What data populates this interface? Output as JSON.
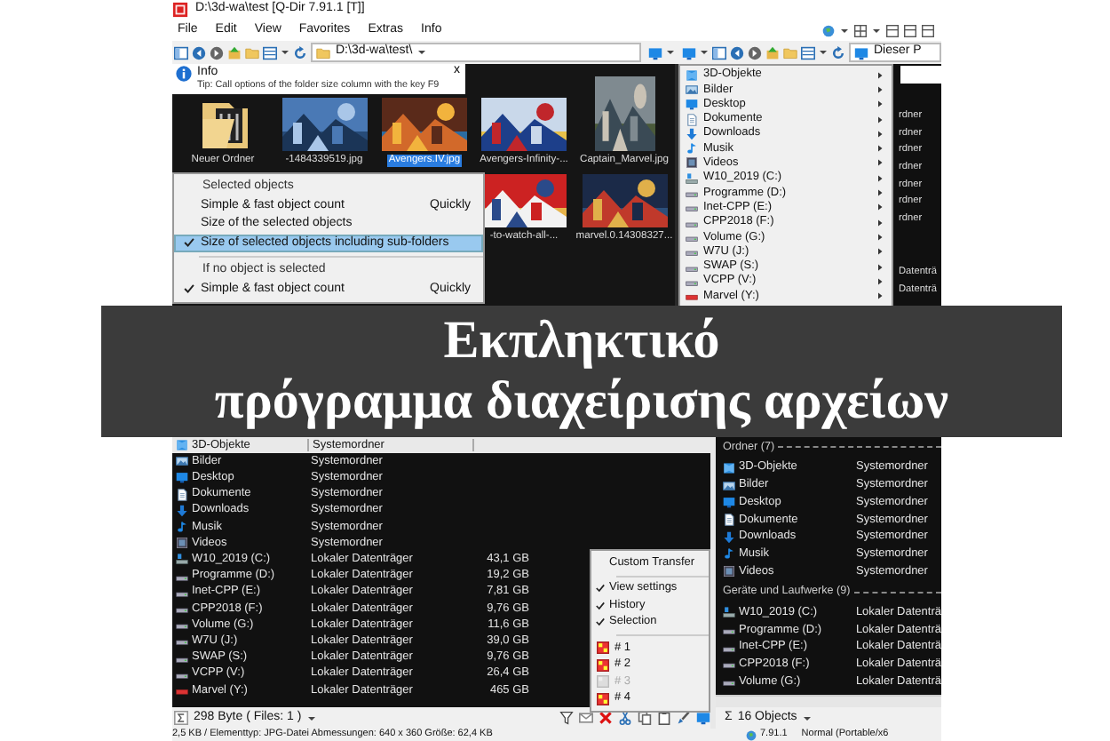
{
  "window": {
    "title": "D:\\3d-wa\\test  [Q-Dir 7.91.1 [T]]"
  },
  "menu": [
    "File",
    "Edit",
    "View",
    "Favorites",
    "Extras",
    "Info"
  ],
  "address_bar": {
    "value": "D:\\3d-wa\\test\\"
  },
  "right_address": {
    "value": "Dieser P"
  },
  "info_bar": {
    "title": "Info",
    "tip": "Tip: Call options of the folder size column with the key F9",
    "close": "x"
  },
  "thumbnails": [
    {
      "label": "Neuer Ordner",
      "kind": "folder",
      "selected": false
    },
    {
      "label": "-1484339519.jpg",
      "kind": "picture",
      "selected": false
    },
    {
      "label": "Avengers.IV.jpg",
      "kind": "picture",
      "selected": true
    },
    {
      "label": "Avengers-Infinity-...",
      "kind": "picture",
      "selected": false
    },
    {
      "label": "Captain_Marvel.jpg",
      "kind": "picture",
      "selected": false
    },
    {
      "label": "-to-watch-all-...",
      "kind": "picture",
      "selected": false
    },
    {
      "label": "marvel.0.14308327...",
      "kind": "picture",
      "selected": false
    }
  ],
  "size_menu": {
    "items": [
      {
        "kind": "header",
        "label": "Selected objects"
      },
      {
        "kind": "item",
        "label": "Simple & fast object count",
        "shortcut": "Quickly",
        "checked": false,
        "selected": false
      },
      {
        "kind": "item",
        "label": "Size of the selected objects",
        "checked": false,
        "selected": false
      },
      {
        "kind": "item",
        "label": "Size of selected objects including sub-folders",
        "checked": true,
        "selected": true
      },
      {
        "kind": "separator"
      },
      {
        "kind": "header",
        "label": "If no object is selected"
      },
      {
        "kind": "item",
        "label": "Simple & fast object count",
        "shortcut": "Quickly",
        "checked": true,
        "selected": false
      }
    ]
  },
  "places_menu": {
    "items": [
      {
        "label": "3D-Objekte",
        "kind": "cube"
      },
      {
        "label": "Bilder",
        "kind": "pictures"
      },
      {
        "label": "Desktop",
        "kind": "desktop"
      },
      {
        "label": "Dokumente",
        "kind": "documents"
      },
      {
        "label": "Downloads",
        "kind": "downloads"
      },
      {
        "label": "Musik",
        "kind": "music"
      },
      {
        "label": "Videos",
        "kind": "videos"
      },
      {
        "label": "W10_2019 (C:)",
        "kind": "system-drive"
      },
      {
        "label": "Programme (D:)",
        "kind": "drive"
      },
      {
        "label": "Inet-CPP (E:)",
        "kind": "drive"
      },
      {
        "label": "CPP2018 (F:)",
        "kind": "drive"
      },
      {
        "label": "Volume (G:)",
        "kind": "drive"
      },
      {
        "label": "W7U (J:)",
        "kind": "drive"
      },
      {
        "label": "SWAP (S:)",
        "kind": "drive"
      },
      {
        "label": "VCPP (V:)",
        "kind": "drive"
      },
      {
        "label": "Marvel (Y:)",
        "kind": "media-drive"
      }
    ]
  },
  "top_right_pane": {
    "cut_cells": [
      "rdner",
      "rdner",
      "rdner",
      "rdner",
      "rdner",
      "rdner",
      "rdner",
      "Datenträ",
      "Datenträ"
    ]
  },
  "list": {
    "rows": [
      {
        "name": "3D-Objekte",
        "type": "Systemordner",
        "kind": "cube",
        "selected": true
      },
      {
        "name": "Bilder",
        "type": "Systemordner",
        "kind": "pictures",
        "selected": false
      },
      {
        "name": "Desktop",
        "type": "Systemordner",
        "kind": "desktop",
        "selected": false
      },
      {
        "name": "Dokumente",
        "type": "Systemordner",
        "kind": "documents",
        "selected": false
      },
      {
        "name": "Downloads",
        "type": "Systemordner",
        "kind": "downloads",
        "selected": false
      },
      {
        "name": "Musik",
        "type": "Systemordner",
        "kind": "music",
        "selected": false
      },
      {
        "name": "Videos",
        "type": "Systemordner",
        "kind": "videos",
        "selected": false
      },
      {
        "name": "W10_2019 (C:)",
        "type": "Lokaler Datenträger",
        "size": "43,1 GB",
        "kind": "system-drive",
        "selected": false
      },
      {
        "name": "Programme (D:)",
        "type": "Lokaler Datenträger",
        "size": "19,2 GB",
        "kind": "drive",
        "selected": false
      },
      {
        "name": "Inet-CPP (E:)",
        "type": "Lokaler Datenträger",
        "size": "7,81 GB",
        "kind": "drive",
        "selected": false
      },
      {
        "name": "CPP2018 (F:)",
        "type": "Lokaler Datenträger",
        "size": "9,76 GB",
        "kind": "drive",
        "selected": false
      },
      {
        "name": "Volume (G:)",
        "type": "Lokaler Datenträger",
        "size": "11,6 GB",
        "kind": "drive",
        "selected": false
      },
      {
        "name": "W7U (J:)",
        "type": "Lokaler Datenträger",
        "size": "39,0 GB",
        "kind": "drive",
        "selected": false
      },
      {
        "name": "SWAP (S:)",
        "type": "Lokaler Datenträger",
        "size": "9,76 GB",
        "kind": "drive",
        "selected": false
      },
      {
        "name": "VCPP (V:)",
        "type": "Lokaler Datenträger",
        "size": "26,4 GB",
        "kind": "drive",
        "selected": false
      },
      {
        "name": "Marvel (Y:)",
        "type": "Lokaler Datenträger",
        "size": "465 GB",
        "kind": "media-drive",
        "selected": false
      }
    ]
  },
  "transfer_menu": {
    "title": "Custom Transfer",
    "options": [
      {
        "label": "View settings",
        "checked": true
      },
      {
        "label": "History",
        "checked": true
      },
      {
        "label": "Selection",
        "checked": true
      }
    ],
    "slots": [
      {
        "label": "# 1",
        "disabled": false
      },
      {
        "label": "# 2",
        "disabled": false
      },
      {
        "label": "# 3",
        "disabled": true
      },
      {
        "label": "# 4",
        "disabled": false
      }
    ]
  },
  "right_pane": {
    "groups": [
      {
        "title": "Ordner (7)",
        "items": [
          {
            "name": "3D-Objekte",
            "type": "Systemordner",
            "kind": "cube"
          },
          {
            "name": "Bilder",
            "type": "Systemordner",
            "kind": "pictures"
          },
          {
            "name": "Desktop",
            "type": "Systemordner",
            "kind": "desktop"
          },
          {
            "name": "Dokumente",
            "type": "Systemordner",
            "kind": "documents"
          },
          {
            "name": "Downloads",
            "type": "Systemordner",
            "kind": "downloads"
          },
          {
            "name": "Musik",
            "type": "Systemordner",
            "kind": "music"
          },
          {
            "name": "Videos",
            "type": "Systemordner",
            "kind": "videos"
          }
        ]
      },
      {
        "title": "Geräte und Laufwerke (9)",
        "items": [
          {
            "name": "W10_2019 (C:)",
            "type": "Lokaler Datenträ",
            "kind": "system-drive"
          },
          {
            "name": "Programme (D:)",
            "type": "Lokaler Datenträ",
            "kind": "drive"
          },
          {
            "name": "Inet-CPP (E:)",
            "type": "Lokaler Datenträ",
            "kind": "drive"
          },
          {
            "name": "CPP2018 (F:)",
            "type": "Lokaler Datenträ",
            "kind": "drive"
          },
          {
            "name": "Volume (G:)",
            "type": "Lokaler Datenträ",
            "kind": "drive"
          }
        ]
      }
    ]
  },
  "status_left": {
    "text": "298 Byte ( Files: 1 )"
  },
  "status_right": {
    "sigma": "Σ",
    "text": "16 Objects"
  },
  "info_line": {
    "text": "2,5 KB / Elementtyp: JPG-Datei Abmessungen: 640 x 360 Größe: 62,4 KB"
  },
  "version": {
    "text": "7.91.1"
  },
  "mode": {
    "text": "Normal (Portable/x6"
  },
  "banner": {
    "lines": [
      "Εκπληκτικό",
      "πρόγραμμα διαχείρισης αρχείων"
    ]
  }
}
